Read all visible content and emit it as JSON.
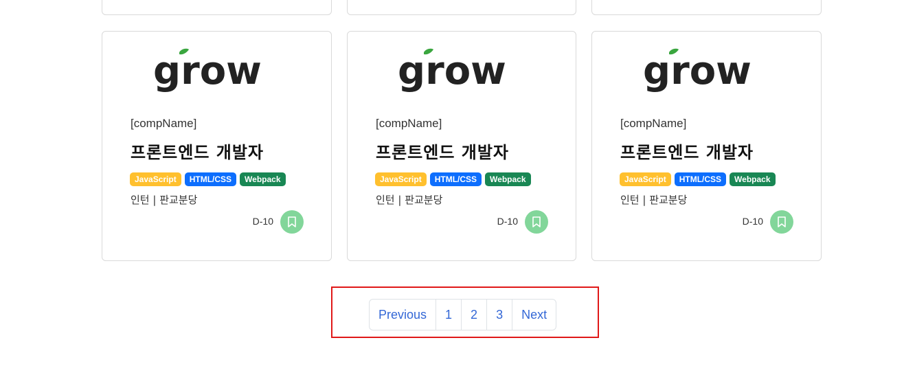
{
  "cards": [
    {
      "logo_text": "grow",
      "company": "[compName]",
      "title": "프론트엔드 개발자",
      "tags": [
        "JavaScript",
        "HTML/CSS",
        "Webpack"
      ],
      "meta": "인턴 | 판교분당",
      "dday": "D-10",
      "bookmark_icon": "bookmark-icon"
    },
    {
      "logo_text": "grow",
      "company": "[compName]",
      "title": "프론트엔드 개발자",
      "tags": [
        "JavaScript",
        "HTML/CSS",
        "Webpack"
      ],
      "meta": "인턴 | 판교분당",
      "dday": "D-10",
      "bookmark_icon": "bookmark-icon"
    },
    {
      "logo_text": "grow",
      "company": "[compName]",
      "title": "프론트엔드 개발자",
      "tags": [
        "JavaScript",
        "HTML/CSS",
        "Webpack"
      ],
      "meta": "인턴 | 판교분당",
      "dday": "D-10",
      "bookmark_icon": "bookmark-icon"
    }
  ],
  "pagination": {
    "previous": "Previous",
    "pages": [
      "1",
      "2",
      "3"
    ],
    "next": "Next"
  },
  "colors": {
    "tag_javascript": "#ffc02e",
    "tag_html_css": "#0d6efd",
    "tag_webpack": "#198754",
    "bookmark_button": "#82d69a",
    "pagination_link": "#3367d6",
    "highlight_border": "#e01818",
    "logo_leaf": "#3aa63f"
  }
}
